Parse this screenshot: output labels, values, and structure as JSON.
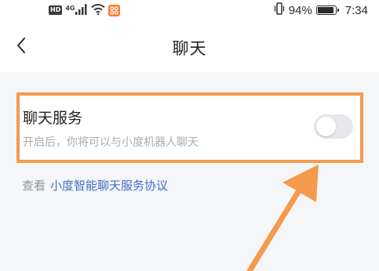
{
  "status_bar": {
    "hd_label": "HD",
    "network_label": "4G",
    "battery_percent": "94%",
    "battery_level": 0.94,
    "time": "7:34"
  },
  "nav": {
    "title": "聊天"
  },
  "setting": {
    "title": "聊天服务",
    "subtitle": "开启后，你将可以与小度机器人聊天",
    "enabled": false
  },
  "agreement": {
    "prefix": "查看",
    "link": "小度智能聊天服务协议"
  },
  "colors": {
    "highlight": "#f59a4c",
    "link": "#3d6fc4",
    "toggle_off": "#e6e7ea"
  }
}
